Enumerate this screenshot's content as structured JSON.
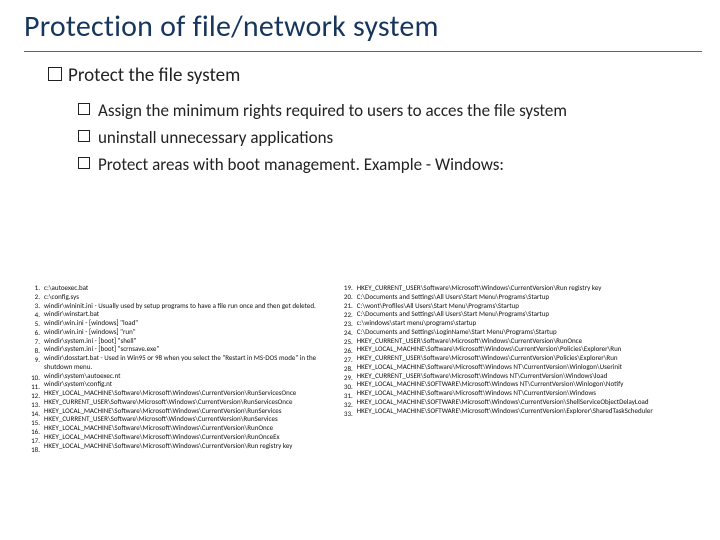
{
  "title": "Protection of file/network system",
  "section_heading": "Protect the file system",
  "bullets": [
    "Assign the minimum rights required to users to acces the file system",
    "uninstall unnecessary applications",
    "Protect areas with boot management. Example - Windows:"
  ],
  "list_left": [
    "c:\\autoexec.bat",
    "c:\\config.sys",
    "windir\\wininit.ini - Usually used by setup programs to have a file run once and then get deleted.",
    "windir\\winstart.bat",
    "windir\\win.ini - [windows] \"load\"",
    "windir\\win.ini - [windows] \"run\"",
    "windir\\system.ini - [boot] \"shell\"",
    "windir\\system.ini - [boot] \"scrnsave.exe\"",
    "windir\\dosstart.bat - Used in Win95 or 98 when you select the \"Restart in MS-DOS mode\" in the shutdown menu.",
    "windir\\system\\autoexec.nt",
    "windir\\system\\config.nt",
    "HKEY_LOCAL_MACHINE\\Software\\Microsoft\\Windows\\CurrentVersion\\RunServicesOnce",
    "HKEY_CURRENT_USER\\Software\\Microsoft\\Windows\\CurrentVersion\\RunServicesOnce",
    "HKEY_LOCAL_MACHINE\\Software\\Microsoft\\Windows\\CurrentVersion\\RunServices",
    "HKEY_CURRENT_USER\\Software\\Microsoft\\Windows\\CurrentVersion\\RunServices",
    "HKEY_LOCAL_MACHINE\\Software\\Microsoft\\Windows\\CurrentVersion\\RunOnce",
    "HKEY_LOCAL_MACHINE\\Software\\Microsoft\\Windows\\CurrentVersion\\RunOnceEx",
    "HKEY_LOCAL_MACHINE\\Software\\Microsoft\\Windows\\CurrentVersion\\Run registry key"
  ],
  "list_right": [
    "HKEY_CURRENT_USER\\Software\\Microsoft\\Windows\\CurrentVersion\\Run registry key",
    "C:\\Documents and Settings\\All Users\\Start Menu\\Programs\\Startup",
    "C:\\wont\\Profiles\\All Users\\Start Menu\\Programs\\Startup",
    "C:\\Documents and Settings\\All Users\\Start Menu\\Programs\\Startup",
    "c:\\windows\\start menu\\programs\\startup",
    "C:\\Documents and Settings\\LoginName\\Start Menu\\Programs\\Startup",
    "HKEY_CURRENT_USER\\Software\\Microsoft\\Windows\\CurrentVersion\\RunOnce",
    "HKEY_LOCAL_MACHINE\\Software\\Microsoft\\Windows\\CurrentVersion\\Policies\\Explorer\\Run",
    "HKEY_CURRENT_USER\\Software\\Microsoft\\Windows\\CurrentVersion\\Policies\\Explorer\\Run",
    "HKEY_LOCAL_MACHINE\\Software\\Microsoft\\Windows NT\\CurrentVersion\\Winlogon\\Userinit",
    "HKEY_CURRENT_USER\\Software\\Microsoft\\Windows NT\\CurrentVersion\\Windows\\load",
    "HKEY_LOCAL_MACHINE\\SOFTWARE\\Microsoft\\Windows NT\\CurrentVersion\\Winlogon\\Notify",
    "HKEY_LOCAL_MACHINE\\Software\\Microsoft\\Windows NT\\CurrentVersion\\Windows",
    "HKEY_LOCAL_MACHINE\\SOFTWARE\\Microsoft\\Windows\\CurrentVersion\\ShellServiceObjectDelayLoad",
    "HKEY_LOCAL_MACHINE\\SOFTWARE\\Microsoft\\Windows\\CurrentVersion\\Explorer\\SharedTaskScheduler"
  ],
  "list_left_start": 1,
  "list_right_start": 19
}
